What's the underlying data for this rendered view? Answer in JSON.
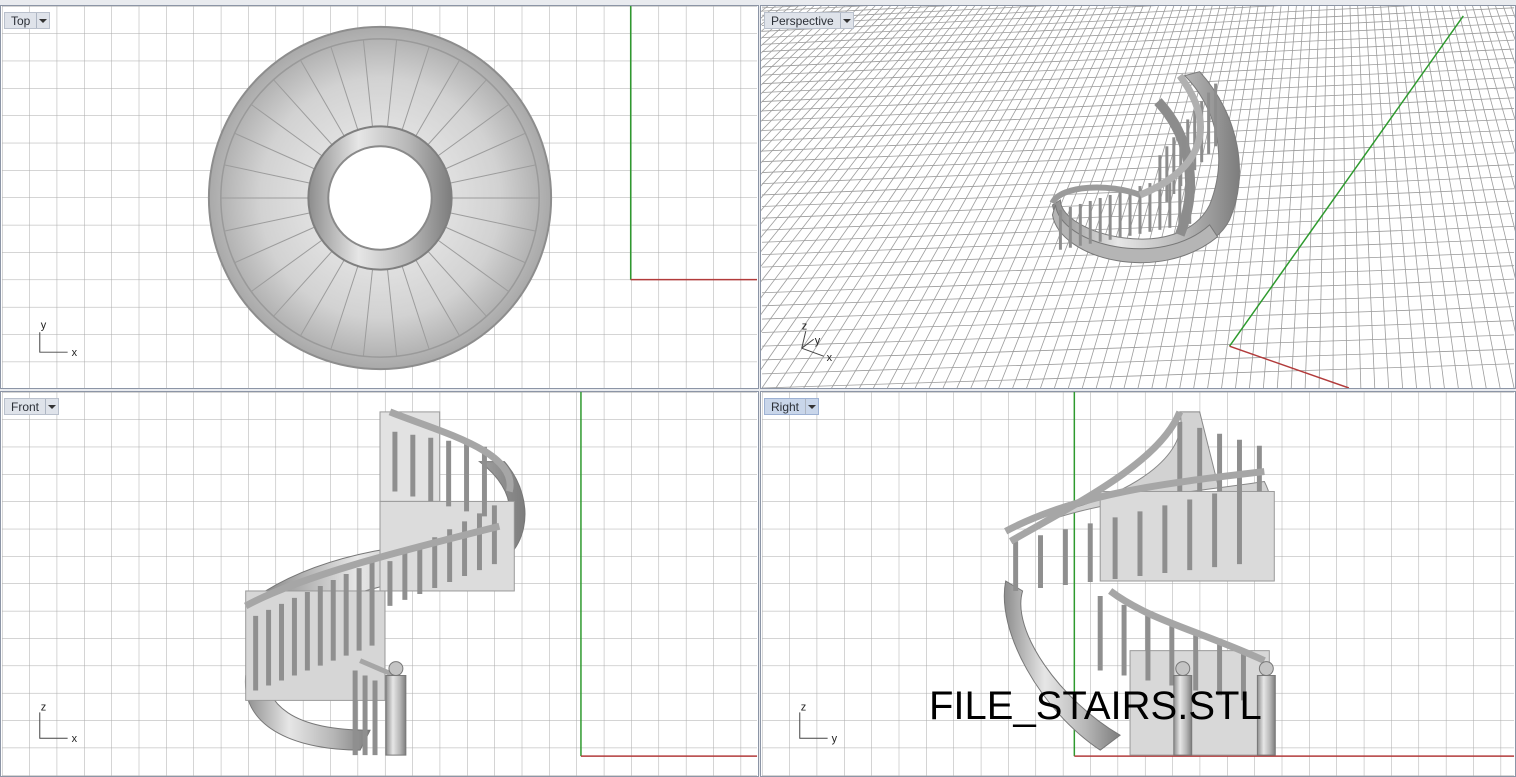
{
  "viewports": {
    "top": {
      "label": "Top",
      "axes": {
        "a": "y",
        "b": "x"
      }
    },
    "perspective": {
      "label": "Perspective",
      "axes": {
        "a": "z",
        "b": "y",
        "c": "x"
      }
    },
    "front": {
      "label": "Front",
      "axes": {
        "a": "z",
        "b": "x"
      }
    },
    "right": {
      "label": "Right",
      "axes": {
        "a": "z",
        "b": "y"
      }
    }
  },
  "active_viewport": "Right",
  "caption": "FILE_STAIRS.STL",
  "colors": {
    "grid": "#a9a9a9",
    "axis_x": "#b23b3b",
    "axis_y": "#2e9a2e",
    "model": "#bfbfbf",
    "active_tab": "#c9d6ea"
  },
  "icons": {
    "viewport_menu": "chevron-down-icon"
  }
}
